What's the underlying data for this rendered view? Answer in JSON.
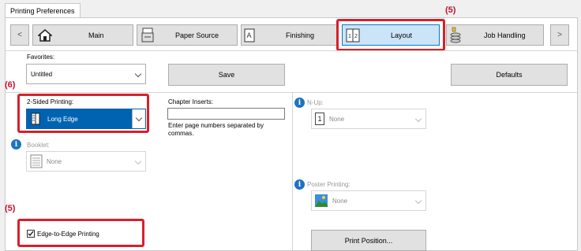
{
  "window": {
    "tab_title": "Printing Preferences"
  },
  "nav": {
    "prev": "<",
    "next": ">",
    "tabs": [
      {
        "label": "Main",
        "icon": "home-icon"
      },
      {
        "label": "Paper Source",
        "icon": "paper-tray-icon"
      },
      {
        "label": "Finishing",
        "icon": "finishing-icon"
      },
      {
        "label": "Layout",
        "icon": "layout-icon",
        "selected": true
      },
      {
        "label": "Job Handling",
        "icon": "job-handling-icon"
      }
    ]
  },
  "favorites": {
    "label": "Favorites:",
    "value": "Untitled",
    "save": "Save",
    "defaults": "Defaults"
  },
  "two_sided": {
    "label": "2-Sided Printing:",
    "value": "Long Edge"
  },
  "chapter": {
    "label": "Chapter Inserts:",
    "value": "",
    "help": "Enter page numbers separated by commas."
  },
  "nup": {
    "label": "N-Up:",
    "value": "None",
    "icon_text": "1"
  },
  "booklet": {
    "label": "Booklet:",
    "value": "None"
  },
  "poster": {
    "label": "Poster Printing:",
    "value": "None"
  },
  "edge": {
    "label": "Edge-to-Edge Printing",
    "checked": true
  },
  "print_position": {
    "label": "Print Position..."
  },
  "callouts": {
    "layout_tab": "(5)",
    "two_sided": "(6)",
    "edge": "(5)"
  },
  "colors": {
    "accent": "#0063b1",
    "callout_red": "#d7202a"
  }
}
